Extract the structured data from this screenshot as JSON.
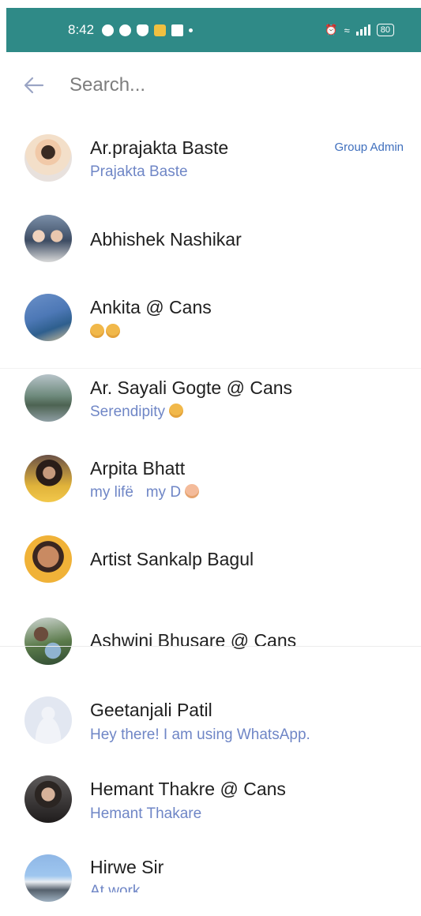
{
  "status_bar": {
    "time": "8:42",
    "battery": "80",
    "bg_color": "#2f8a87"
  },
  "search": {
    "placeholder": "Search...",
    "value": ""
  },
  "contacts": [
    {
      "name": "Ar.prajakta Baste",
      "status": "Prajakta Baste",
      "badge": "Group Admin"
    },
    {
      "name": "Abhishek Nashikar",
      "status": ""
    },
    {
      "name": "Ankita @ Cans",
      "status": "",
      "status_emojis": 2
    },
    {
      "name": "Ar. Sayali Gogte @ Cans",
      "status": "Serendipity",
      "status_emojis": 1
    },
    {
      "name": "Arpita Bhatt",
      "status": "my lifë   my D"
    },
    {
      "name": "Artist Sankalp Bagul",
      "status": ""
    },
    {
      "name": "Ashwini Bhusare @ Cans",
      "status": ""
    },
    {
      "name": "Geetanjali Patil",
      "status": "Hey there! I am using WhatsApp."
    },
    {
      "name": "Hemant Thakre @ Cans",
      "status": "Hemant Thakare"
    },
    {
      "name": "Hirwe Sir",
      "status": "At work"
    }
  ],
  "colors": {
    "accent": "#2f8a87",
    "status_text": "#6f86c6",
    "admin_badge": "#3f6fbd"
  }
}
